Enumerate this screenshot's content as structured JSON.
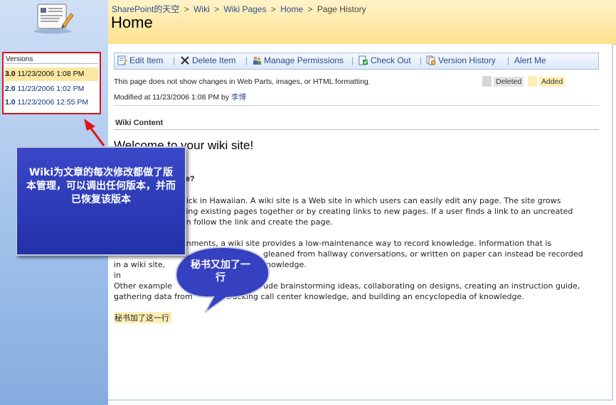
{
  "sidebar": {
    "logo_icon": "wiki-page-icon",
    "versions_title": "Versions",
    "versions": [
      {
        "number": "3.0",
        "date": "11/23/2006 1:08 PM",
        "current": true
      },
      {
        "number": "2.0",
        "date": "11/23/2006 1:02 PM",
        "current": false
      },
      {
        "number": "1.0",
        "date": "11/23/2006 12:55 PM",
        "current": false
      }
    ]
  },
  "header": {
    "breadcrumb": [
      "SharePoint的天空",
      "Wiki",
      "Wiki Pages",
      "Home",
      "Page History"
    ],
    "breadcrumb_sep": ">",
    "title": "Home"
  },
  "toolbar": {
    "items": [
      {
        "label": "Edit Item",
        "icon": "edit-item-icon"
      },
      {
        "label": "Delete Item",
        "icon": "delete-x-icon"
      },
      {
        "label": "Manage Permissions",
        "icon": "permissions-icon"
      },
      {
        "label": "Check Out",
        "icon": "check-out-icon"
      },
      {
        "label": "Version History",
        "icon": "version-history-icon"
      },
      {
        "label": "Alert Me",
        "icon": ""
      }
    ],
    "separator": "|"
  },
  "notice": "This page does not show changes in Web Parts, images, or HTML formatting.",
  "legend": {
    "deleted": "Deleted",
    "added": "Added"
  },
  "modified": {
    "prefix": "Modified at 11/23/2006 1:08 PM  by",
    "author": "李博"
  },
  "content": {
    "section_label": "Wiki Content",
    "welcome": "Welcome to your wiki site!",
    "question": "ite?",
    "para1_line1": "uick in Hawaiian. A wiki site is a Web site in which users can easily edit any page. The site grows",
    "para1_line2": "king existing pages together or by creating links to new pages. If a user finds a link to an uncreated",
    "para1_line3": "an follow the link and create the page.",
    "para2_line1": "onments, a wiki site provides a low-maintenance way to record knowledge. Information that is",
    "para2_line2": "gleaned from hallway conversations, or written on paper can instead be recorded",
    "para2_line3a": "in a wiki site, in",
    "para2_line3b": "nowledge.",
    "para3_line1a": "Other example u",
    "para3_line1b": "ude brainstorming ideas, collaborating on designs, creating an instruction guide,",
    "para3_line2a": "gathering data from",
    "para3_line2b": "tracking call center knowledge, and building an encyclopedia of knowledge.",
    "added_line": "秘书加了这一行"
  },
  "annotations": {
    "callout1": "Wiki为文章的每次修改都做了版本管理，可以调出任何版本，并而已恢复该版本",
    "callout2": "秘书又加了一行"
  },
  "colors": {
    "header_bg": "#fde18d",
    "highlight_red": "#e01414",
    "callout_blue": "#2a38b8",
    "added_yellow": "#fdeeb6",
    "deleted_gray": "#d6d6d6"
  }
}
